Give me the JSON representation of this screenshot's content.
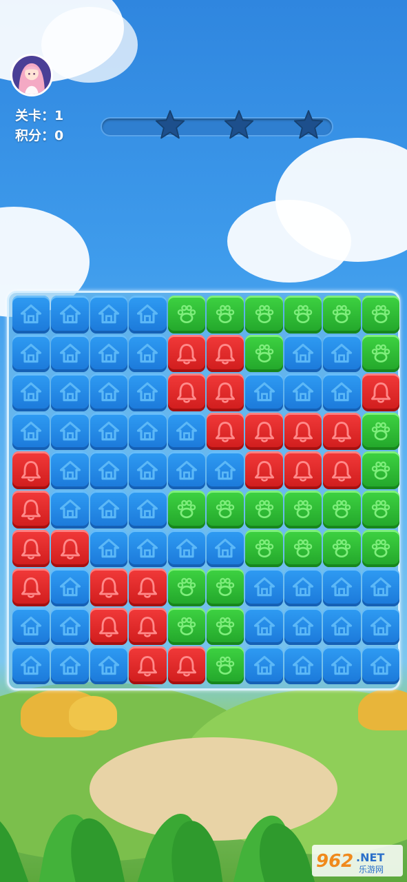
{
  "hud": {
    "level_text": "关卡：1",
    "score_text": "积分：0",
    "stars_total": 3,
    "stars_earned": 0,
    "progress": 0
  },
  "board": {
    "rows": 10,
    "cols": 10,
    "tiles": [
      "BBBBGGGGGG",
      "BBBBRRGBBG",
      "BBBBRRBBBR",
      "BBBBBRRRRG",
      "RBBBBBRRRG",
      "RBBBGGGGGG",
      "RRBBBBGGGG",
      "RBRRGGBBBB",
      "BBRRGGBBBB",
      "BBBRRGBBBB"
    ],
    "tile_types": {
      "B": {
        "color": "blue",
        "icon": "house-icon"
      },
      "G": {
        "color": "green",
        "icon": "paw-icon"
      },
      "R": {
        "color": "red",
        "icon": "bell-icon"
      }
    }
  },
  "colors": {
    "blue": "#1b78d9",
    "green": "#22a52a",
    "red": "#cf1c1c",
    "star_empty": "#1d4f8c",
    "progress_track": "#2f7fd0"
  },
  "watermark": {
    "text": "962.NET",
    "subtext": "乐游网"
  }
}
